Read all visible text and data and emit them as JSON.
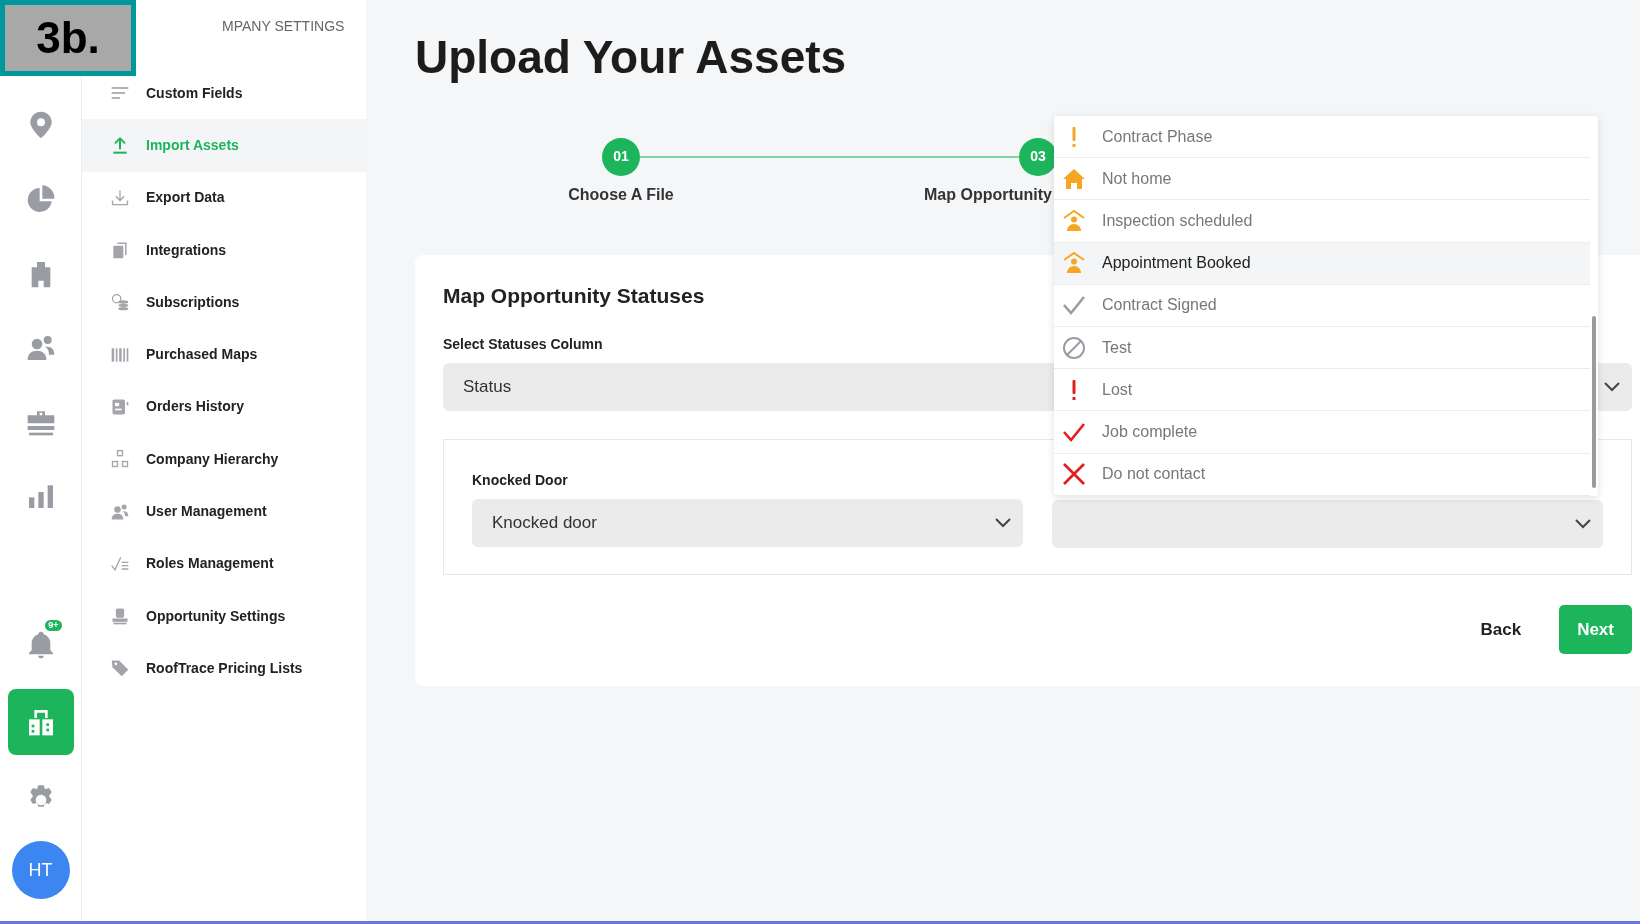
{
  "badge": "3b.",
  "rail": {
    "items": [
      {
        "kind": "pin",
        "selected": false
      },
      {
        "kind": "pie",
        "selected": false
      },
      {
        "kind": "building",
        "selected": false
      },
      {
        "kind": "users",
        "selected": false
      },
      {
        "kind": "briefcase",
        "selected": false
      },
      {
        "kind": "bars",
        "selected": false
      },
      {
        "kind": "bell",
        "selected": false,
        "count": "9+"
      },
      {
        "kind": "company",
        "selected": true
      },
      {
        "kind": "gear",
        "selected": false
      }
    ],
    "avatar": "HT"
  },
  "sidebar": {
    "heading": "MPANY SETTINGS",
    "items": [
      {
        "label": "Custom Fields",
        "kind": "lines",
        "selected": false
      },
      {
        "label": "Import Assets",
        "kind": "upload",
        "selected": true
      },
      {
        "label": "Export Data",
        "kind": "download",
        "selected": false
      },
      {
        "label": "Integrations",
        "kind": "copy",
        "selected": false
      },
      {
        "label": "Subscriptions",
        "kind": "coins",
        "selected": false
      },
      {
        "label": "Purchased Maps",
        "kind": "barcode",
        "selected": false
      },
      {
        "label": "Orders History",
        "kind": "receipt",
        "selected": false
      },
      {
        "label": "Company Hierarchy",
        "kind": "hierarchy",
        "selected": false
      },
      {
        "label": "User Management",
        "kind": "users",
        "selected": false
      },
      {
        "label": "Roles Management",
        "kind": "checklist",
        "selected": false
      },
      {
        "label": "Opportunity Settings",
        "kind": "stamp",
        "selected": false
      },
      {
        "label": "RoofTrace Pricing Lists",
        "kind": "tag",
        "selected": false
      }
    ]
  },
  "page_title": "Upload Your Assets",
  "stepper": [
    {
      "number": "01",
      "label": "Choose A File"
    },
    {
      "number": "03",
      "label": "Map Opportunity"
    }
  ],
  "card": {
    "title": "Map Opportunity Statuses",
    "statuses_column": {
      "label": "Select Statuses Column",
      "value": "Status"
    },
    "mapping": {
      "label": "Knocked Door",
      "value": "Knocked door"
    }
  },
  "dropdown": {
    "items": [
      {
        "label": "Contract Phase",
        "kind": "exclaim",
        "color": "#f5a623",
        "selected": false
      },
      {
        "label": "Not home",
        "kind": "house",
        "color": "#f5a623",
        "selected": false
      },
      {
        "label": "Inspection scheduled",
        "kind": "person-roof",
        "color": "#f5a623",
        "selected": false
      },
      {
        "label": "Appointment Booked",
        "kind": "person-roof",
        "color": "#f5a623",
        "selected": true
      },
      {
        "label": "Contract Signed",
        "kind": "check",
        "color": "#9a9ca3",
        "selected": false
      },
      {
        "label": "Test",
        "kind": "ban",
        "color": "#9a9ca3",
        "selected": false
      },
      {
        "label": "Lost",
        "kind": "exclaim",
        "color": "#e02020",
        "selected": false
      },
      {
        "label": "Job complete",
        "kind": "check",
        "color": "#e02020",
        "selected": false
      },
      {
        "label": "Do not contact",
        "kind": "x",
        "color": "#e02020",
        "selected": false
      }
    ]
  },
  "buttons": {
    "back": "Back",
    "next": "Next"
  }
}
